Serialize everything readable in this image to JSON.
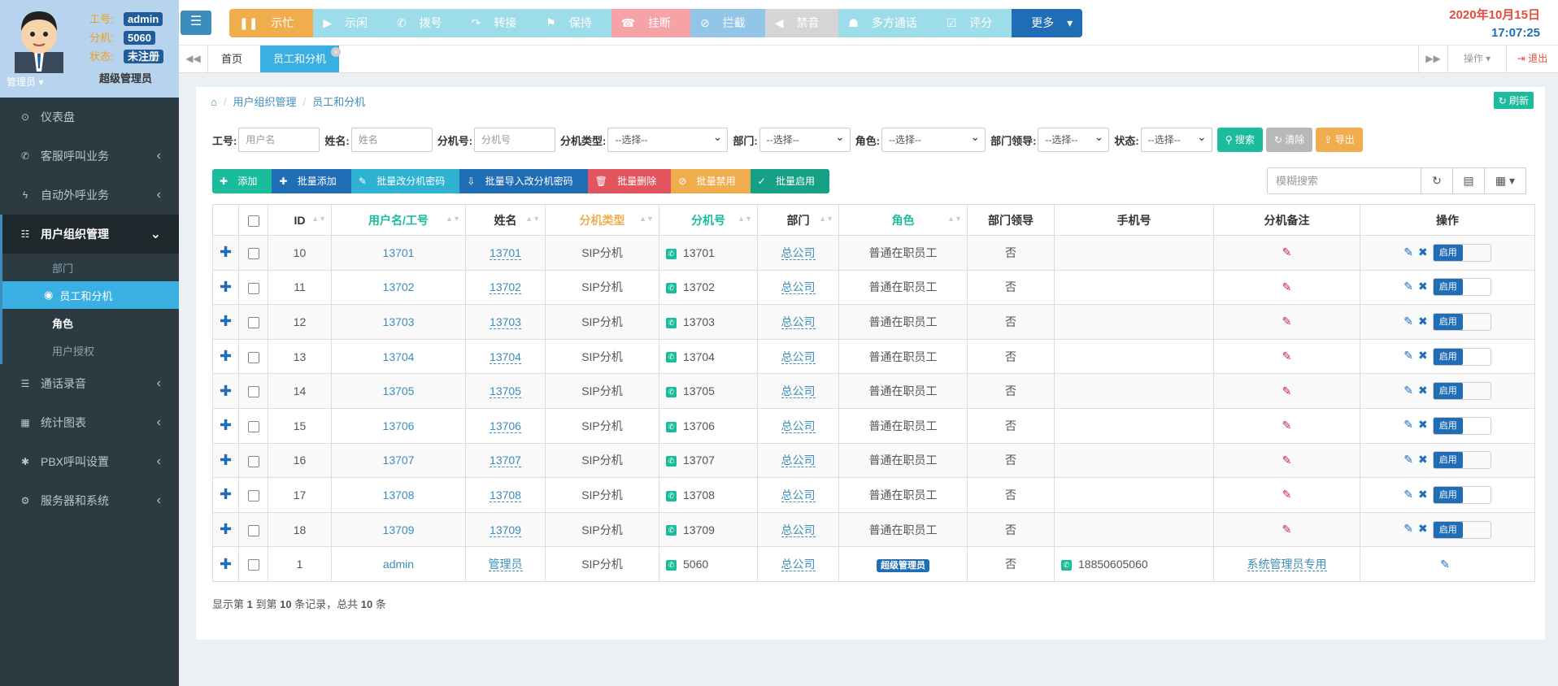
{
  "user": {
    "labels": {
      "id": "工号:",
      "ext": "分机:",
      "status": "状态:"
    },
    "id": "admin",
    "ext": "5060",
    "status": "未注册",
    "name": "管理员",
    "role": "超级管理员"
  },
  "sidebar": {
    "items": [
      {
        "label": "仪表盘",
        "icon": "dashboard-icon"
      },
      {
        "label": "客服呼叫业务",
        "icon": "phone-call-icon"
      },
      {
        "label": "自动外呼业务",
        "icon": "bolt-icon"
      },
      {
        "label": "用户组织管理",
        "icon": "sitemap-icon"
      },
      {
        "label": "通话录音",
        "icon": "list-icon"
      },
      {
        "label": "统计图表",
        "icon": "table-icon"
      },
      {
        "label": "PBX呼叫设置",
        "icon": "asterisk-icon"
      },
      {
        "label": "服务器和系统",
        "icon": "cogs-icon"
      }
    ],
    "sub": [
      "部门",
      "员工和分机",
      "角色",
      "用户授权"
    ]
  },
  "toolbar": {
    "buttons": [
      "示忙",
      "示闲",
      "拨号",
      "转接",
      "保持",
      "挂断",
      "拦截",
      "禁音",
      "多方通话",
      "评分",
      "更多"
    ]
  },
  "datetime": {
    "date": "2020年10月15日",
    "time": "17:07:25"
  },
  "tabs": {
    "home": "首页",
    "current": "员工和分机",
    "ops": "操作",
    "logout": "退出"
  },
  "breadcrumb": [
    "用户组织管理",
    "员工和分机"
  ],
  "refresh_label": "刷新",
  "filter": {
    "labels": [
      "工号:",
      "姓名:",
      "分机号:",
      "分机类型:",
      "部门:",
      "角色:",
      "部门领导:",
      "状态:"
    ],
    "placeholders": [
      "用户名",
      "姓名",
      "分机号"
    ],
    "select_default": "--选择--",
    "search": "搜索",
    "clear": "清除",
    "export": "导出"
  },
  "actions": [
    "添加",
    "批量添加",
    "批量改分机密码",
    "批量导入改分机密码",
    "批量删除",
    "批量禁用",
    "批量启用"
  ],
  "fuzzy_placeholder": "模糊搜索",
  "columns": [
    "ID",
    "用户名/工号",
    "姓名",
    "分机类型",
    "分机号",
    "部门",
    "角色",
    "部门领导",
    "手机号",
    "分机备注",
    "操作"
  ],
  "rows": [
    {
      "id": "10",
      "user": "13701",
      "name": "13701",
      "type": "SIP分机",
      "ext": "13701",
      "dept": "总公司",
      "role": "普通在职员工",
      "leader": "否",
      "phone": "",
      "note": ""
    },
    {
      "id": "11",
      "user": "13702",
      "name": "13702",
      "type": "SIP分机",
      "ext": "13702",
      "dept": "总公司",
      "role": "普通在职员工",
      "leader": "否",
      "phone": "",
      "note": ""
    },
    {
      "id": "12",
      "user": "13703",
      "name": "13703",
      "type": "SIP分机",
      "ext": "13703",
      "dept": "总公司",
      "role": "普通在职员工",
      "leader": "否",
      "phone": "",
      "note": ""
    },
    {
      "id": "13",
      "user": "13704",
      "name": "13704",
      "type": "SIP分机",
      "ext": "13704",
      "dept": "总公司",
      "role": "普通在职员工",
      "leader": "否",
      "phone": "",
      "note": ""
    },
    {
      "id": "14",
      "user": "13705",
      "name": "13705",
      "type": "SIP分机",
      "ext": "13705",
      "dept": "总公司",
      "role": "普通在职员工",
      "leader": "否",
      "phone": "",
      "note": ""
    },
    {
      "id": "15",
      "user": "13706",
      "name": "13706",
      "type": "SIP分机",
      "ext": "13706",
      "dept": "总公司",
      "role": "普通在职员工",
      "leader": "否",
      "phone": "",
      "note": ""
    },
    {
      "id": "16",
      "user": "13707",
      "name": "13707",
      "type": "SIP分机",
      "ext": "13707",
      "dept": "总公司",
      "role": "普通在职员工",
      "leader": "否",
      "phone": "",
      "note": ""
    },
    {
      "id": "17",
      "user": "13708",
      "name": "13708",
      "type": "SIP分机",
      "ext": "13708",
      "dept": "总公司",
      "role": "普通在职员工",
      "leader": "否",
      "phone": "",
      "note": ""
    },
    {
      "id": "18",
      "user": "13709",
      "name": "13709",
      "type": "SIP分机",
      "ext": "13709",
      "dept": "总公司",
      "role": "普通在职员工",
      "leader": "否",
      "phone": "",
      "note": ""
    },
    {
      "id": "1",
      "user": "admin",
      "name": "管理员",
      "type": "SIP分机",
      "ext": "5060",
      "dept": "总公司",
      "role": "超级管理员",
      "leader": "否",
      "phone": "18850605060",
      "note": "系统管理员专用"
    }
  ],
  "enable_label": "启用",
  "footer": {
    "prefix": "显示第 ",
    "from": "1",
    "mid1": " 到第 ",
    "to": "10",
    "mid2": " 条记录，总共 ",
    "total": "10",
    "suffix": " 条"
  }
}
